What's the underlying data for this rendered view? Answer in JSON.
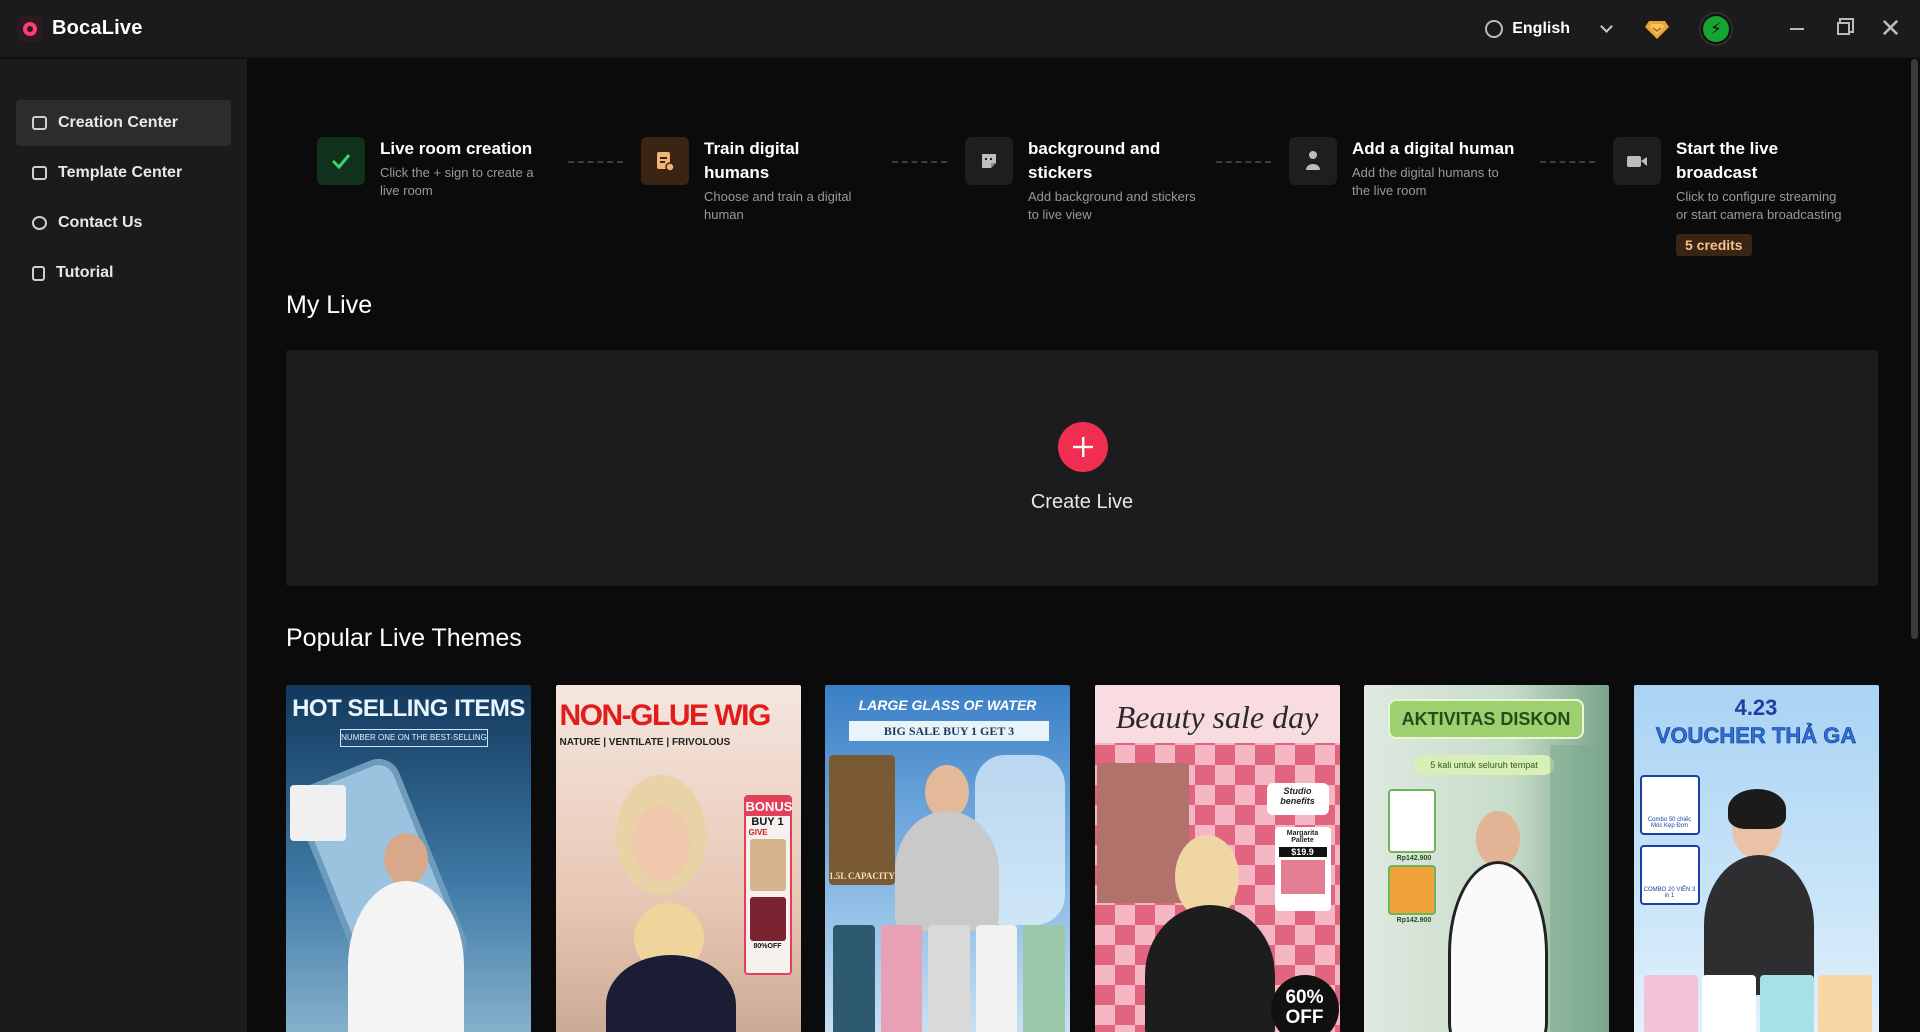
{
  "app": {
    "name": "BocaLive"
  },
  "titlebar": {
    "language": "English"
  },
  "sidebar": {
    "items": [
      {
        "label": "Creation Center",
        "icon": "creation-icon"
      },
      {
        "label": "Template Center",
        "icon": "template-icon"
      },
      {
        "label": "Contact Us",
        "icon": "headset-icon"
      },
      {
        "label": "Tutorial",
        "icon": "document-icon"
      }
    ]
  },
  "steps": [
    {
      "title": "Live room creation",
      "desc": "Click the + sign to create a live room",
      "icon": "check-icon"
    },
    {
      "title": "Train digital humans",
      "desc": "Choose and train a digital human",
      "icon": "train-icon"
    },
    {
      "title": "background and stickers",
      "desc": "Add background and stickers to live view",
      "icon": "sticker-icon"
    },
    {
      "title": "Add a digital human",
      "desc": "Add the digital humans to the live room",
      "icon": "person-icon"
    },
    {
      "title": "Start the live broadcast",
      "desc": "Click to configure streaming or start camera broadcasting",
      "icon": "camera-icon",
      "badge": "5 credits"
    }
  ],
  "my_live": {
    "title": "My Live",
    "create_label": "Create Live"
  },
  "themes": {
    "title": "Popular Live Themes",
    "cards": [
      {
        "banner": "HOT SELLING ITEMS",
        "sub": "NUMBER ONE ON THE BEST-SELLING"
      },
      {
        "banner": "NON-GLUE WIG",
        "sub": "NATURE | VENTILATE | FRIVOLOUS",
        "tag": "BONUS",
        "tag2": "BUY 1",
        "tag3": "GIVE",
        "tag4": "80%OFF"
      },
      {
        "banner": "LARGE GLASS OF WATER",
        "sub": "BIG SALE BUY 1 GET 3",
        "tag": "1.5L CAPACITY"
      },
      {
        "banner": "Beauty sale day",
        "sub": "Studio benefits",
        "tag": "Margarita Pallete",
        "tag2": "$19.9",
        "tag3": "60% OFF"
      },
      {
        "banner": "AKTIVITAS DISKON",
        "sub": "5 kali untuk seluruh tempat",
        "tag": "Rp142.900",
        "tag2": "Rp142.900"
      },
      {
        "banner": "4.23",
        "sub": "VOUCHER THẢ GA",
        "tag": "Combo 50 chiếc Móc Kẹp Đơn",
        "tag2": "COMBO 20 VIÊN 3 in 1"
      }
    ]
  },
  "colors": {
    "accent": "#ef2e52",
    "sidebar_bg": "#1b1b1d",
    "main_bg": "#0b0b0c",
    "credits_bg": "#3a2414"
  }
}
